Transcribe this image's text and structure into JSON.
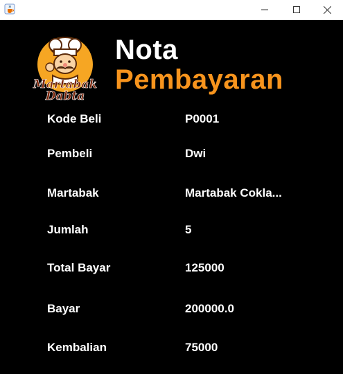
{
  "window": {
    "icon": "java-cup-icon",
    "controls": [
      "minimize-icon",
      "maximize-icon",
      "close-icon"
    ]
  },
  "header": {
    "logo_text_line1": "Martabak",
    "logo_text_line2": "Dabta",
    "title_line1": "Nota",
    "title_line2": "Pembayaran",
    "accent_color": "#f7941d"
  },
  "receipt": {
    "rows": [
      {
        "label": "Kode Beli",
        "value": "P0001"
      },
      {
        "label": "Pembeli",
        "value": "Dwi"
      },
      {
        "label": "Martabak",
        "value": "Martabak Cokla..."
      },
      {
        "label": "Jumlah",
        "value": "5"
      },
      {
        "label": "Total Bayar",
        "value": "125000"
      },
      {
        "label": "Bayar",
        "value": "200000.0"
      },
      {
        "label": "Kembalian",
        "value": "75000"
      }
    ]
  }
}
